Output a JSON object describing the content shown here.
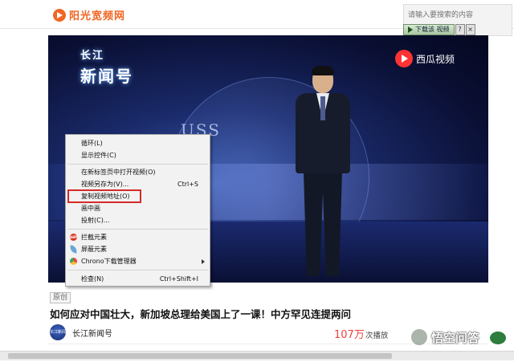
{
  "site": {
    "logo_text": "阳光宽频网"
  },
  "search": {
    "placeholder": "请输入要搜索的内容"
  },
  "download_bar": {
    "button_label": "下载该 视频",
    "help_glyph": "?",
    "close_glyph": "×"
  },
  "video": {
    "overlay_badge": {
      "line1": "长江",
      "line2": "新闻号"
    },
    "watermark": "西瓜视频",
    "background_text": "USS"
  },
  "context_menu": {
    "items": [
      {
        "label": "循环(L)"
      },
      {
        "label": "显示控件(C)"
      },
      {
        "label": "在新标签页中打开视频(O)"
      },
      {
        "label": "视频另存为(V)...",
        "shortcut": "Ctrl+S"
      },
      {
        "label": "复制视频地址(O)",
        "highlighted": true
      },
      {
        "label": "画中画"
      },
      {
        "label": "投射(C)..."
      },
      {
        "label": "拦截元素",
        "icon": "adblock-icon",
        "icon_text": "ABP"
      },
      {
        "label": "屏蔽元素",
        "icon": "leaf-icon"
      },
      {
        "label": "Chrono下载管理器",
        "icon": "chrono-icon",
        "has_submenu": true
      },
      {
        "label": "检查(N)",
        "shortcut": "Ctrl+Shift+I"
      }
    ]
  },
  "article": {
    "tag": "原创",
    "title": "如何应对中国壮大，新加坡总理给美国上了一课！中方罕见连提两问",
    "author": "长江新闻号",
    "avatar_text": "长江新闻号",
    "plays_number": "107万",
    "plays_unit": "次播放"
  },
  "corner_watermark": {
    "text": "悟空问答"
  },
  "colors": {
    "brand": "#f26522",
    "highlight_box": "#d42a2a",
    "plays": "#f04142"
  }
}
